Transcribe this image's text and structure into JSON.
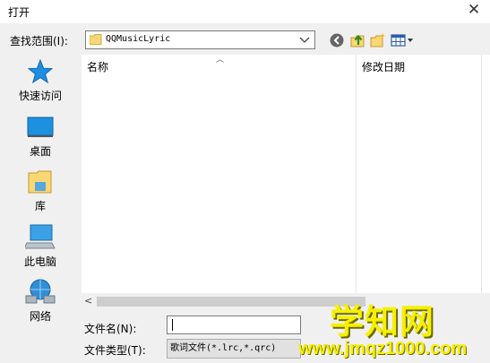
{
  "window": {
    "title": "打开",
    "close_glyph": "✕"
  },
  "lookin": {
    "label": "查找范围(I):",
    "value": "QQMusicLyric"
  },
  "toolbar": {
    "back": "back-icon",
    "up": "up-folder-icon",
    "new_folder": "new-folder-icon",
    "view": "view-menu-icon"
  },
  "places": [
    {
      "label": "快速访问",
      "icon": "star-icon"
    },
    {
      "label": "桌面",
      "icon": "desktop-icon"
    },
    {
      "label": "库",
      "icon": "library-icon"
    },
    {
      "label": "此电脑",
      "icon": "computer-icon"
    },
    {
      "label": "网络",
      "icon": "network-icon"
    }
  ],
  "list": {
    "columns": [
      "名称",
      "修改日期"
    ],
    "items": []
  },
  "filename": {
    "label": "文件名(N):",
    "value": ""
  },
  "filetype": {
    "label": "文件类型(T):",
    "value": "歌词文件(*.lrc,*.qrc)"
  },
  "watermark": {
    "title": "学知网",
    "url": "www.jmqz1000.com"
  },
  "colors": {
    "accent": "#0078d7",
    "watermark": "#f7ef00"
  }
}
